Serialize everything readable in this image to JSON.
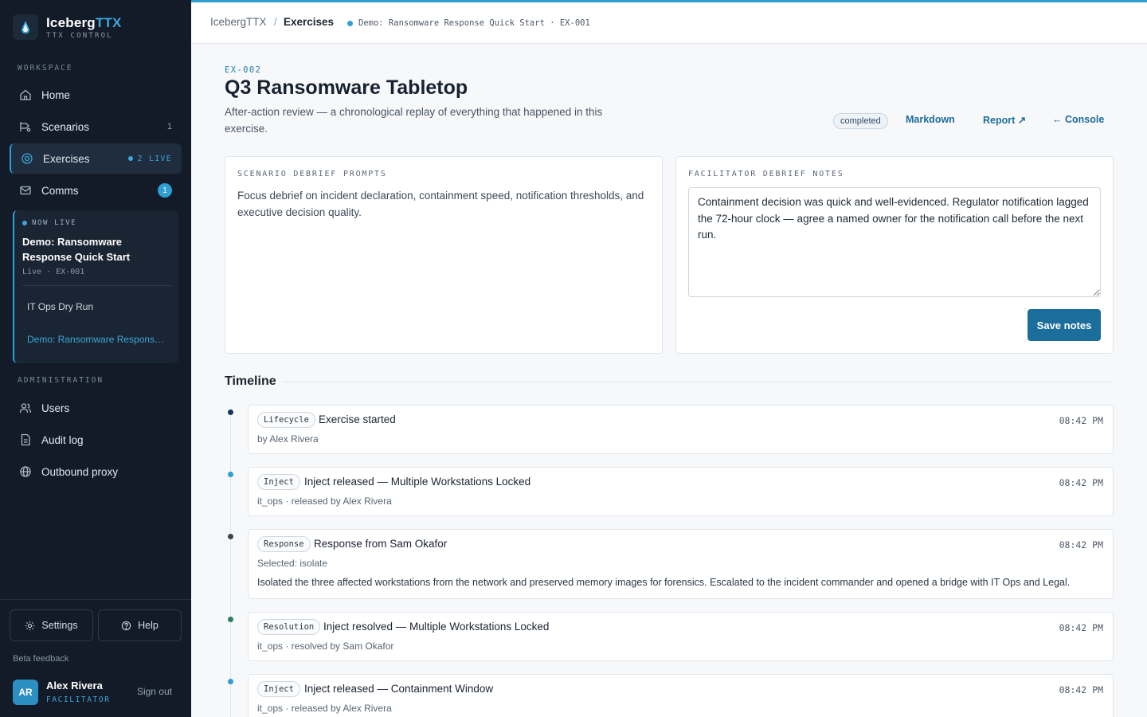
{
  "brand": {
    "name_main": "Iceberg",
    "name_accent": "TTX",
    "subtitle": "TTX CONTROL"
  },
  "sidebar": {
    "workspace_label": "WORKSPACE",
    "items": [
      {
        "label": "Home",
        "icon": "home-icon"
      },
      {
        "label": "Scenarios",
        "icon": "scenarios-icon",
        "count": "1"
      },
      {
        "label": "Exercises",
        "icon": "target-icon",
        "badge": "2 LIVE",
        "active": true
      },
      {
        "label": "Comms",
        "icon": "mail-icon",
        "badge": "1"
      }
    ],
    "live_card": {
      "label": "NOW LIVE",
      "title": "Demo: Ransomware Response Quick Start",
      "meta": "Live · EX-001",
      "links": [
        "IT Ops Dry Run",
        "Demo: Ransomware Response Quick Start"
      ]
    },
    "admin_label": "ADMINISTRATION",
    "admin_items": [
      {
        "label": "Users",
        "icon": "users-icon"
      },
      {
        "label": "Audit log",
        "icon": "document-icon"
      },
      {
        "label": "Outbound proxy",
        "icon": "globe-icon"
      }
    ],
    "settings_label": "Settings",
    "help_label": "Help",
    "beta_feedback": "Beta feedback",
    "user": {
      "initials": "AR",
      "name": "Alex Rivera",
      "role": "FACILITATOR",
      "signout": "Sign out"
    }
  },
  "breadcrumb": {
    "root": "IcebergTTX",
    "sep": "/",
    "current": "Exercises",
    "context": "Demo: Ransomware Response Quick Start · EX-001"
  },
  "exercise": {
    "id": "EX-002",
    "title": "Q3 Ransomware Tabletop",
    "description": "After-action review — a chronological replay of everything that happened in this exercise.",
    "status": "completed",
    "actions": {
      "markdown": "Markdown",
      "report": "Report ↗",
      "console": "← Console"
    }
  },
  "debrief": {
    "prompts_label": "SCENARIO DEBRIEF PROMPTS",
    "prompts_text": "Focus debrief on incident declaration, containment speed, notification thresholds, and executive decision quality.",
    "notes_label": "FACILITATOR DEBRIEF NOTES",
    "notes_value": "Containment decision was quick and well-evidenced. Regulator notification lagged the 72-hour clock — agree a named owner for the notification call before the next run.",
    "save_label": "Save notes"
  },
  "timeline": {
    "heading": "Timeline",
    "events": [
      {
        "tag": "Lifecycle",
        "title": "Exercise started",
        "time": "08:42 PM",
        "sub": "by Alex Rivera",
        "dot_color": "#17385c"
      },
      {
        "tag": "Inject",
        "title": "Inject released — Multiple Workstations Locked",
        "time": "08:42 PM",
        "sub": "it_ops · released by Alex Rivera",
        "dot_color": "#2e9fd3"
      },
      {
        "tag": "Response",
        "title": "Response from Sam Okafor",
        "time": "08:42 PM",
        "sub": "Selected: isolate",
        "body": "Isolated the three affected workstations from the network and preserved memory images for forensics. Escalated to the incident commander and opened a bridge with IT Ops and Legal.",
        "dot_color": "#3b4450"
      },
      {
        "tag": "Resolution",
        "title": "Inject resolved — Multiple Workstations Locked",
        "time": "08:42 PM",
        "sub": "it_ops · resolved by Sam Okafor",
        "dot_color": "#2f7d5b"
      },
      {
        "tag": "Inject",
        "title": "Inject released — Containment Window",
        "time": "08:42 PM",
        "sub": "it_ops · released by Alex Rivera",
        "dot_color": "#2e9fd3"
      }
    ]
  },
  "colors": {
    "accent": "#2e9fd3",
    "primary_button": "#1b6d9c",
    "sidebar_bg": "#121b27"
  }
}
